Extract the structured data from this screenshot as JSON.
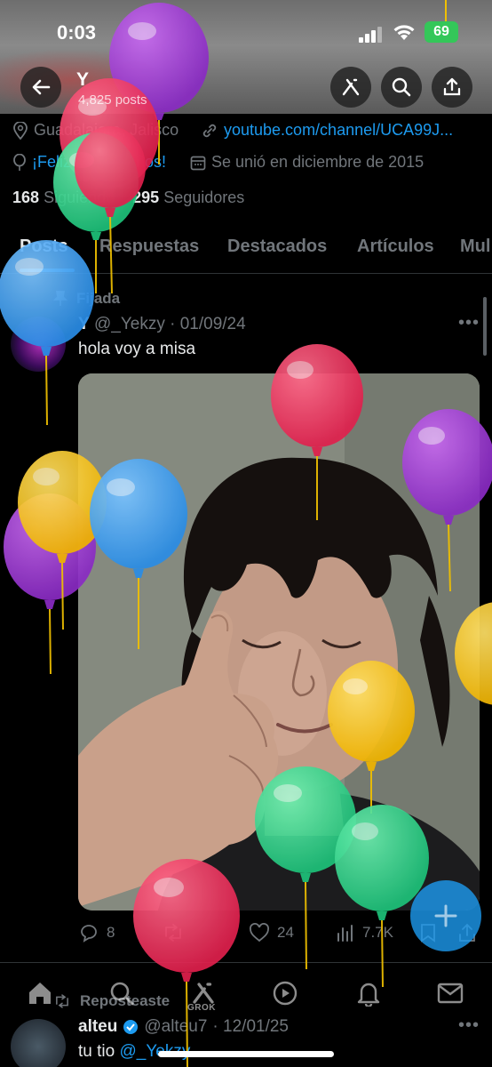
{
  "status_bar": {
    "time": "0:03",
    "battery": "69"
  },
  "header": {
    "name": "Y",
    "posts_count": "4,825 posts"
  },
  "profile": {
    "location": "Guadalajara, Jalisco",
    "website": "youtube.com/channel/UCA99J...",
    "birthday": "¡Feliz cumpleaños!",
    "joined": "Se unió en diciembre de 2015",
    "following_count": "168",
    "following_label": "Siguiendo",
    "followers_count": "295",
    "followers_label": "Seguidores"
  },
  "tabs": [
    "Posts",
    "Respuestas",
    "Destacados",
    "Artículos",
    "Mul"
  ],
  "pinned_post": {
    "pinned_label": "Fijada",
    "author": "Y",
    "handle": "@_Yekzy",
    "date": "· 01/09/24",
    "text": "hola voy a misa",
    "replies": "8",
    "likes": "24",
    "views": "7.7K"
  },
  "repost": {
    "label": "Reposteaste",
    "author": "alteu",
    "handle": "@alteu7",
    "date": "· 12/01/25",
    "text_prefix": "tu tio ",
    "mention": "@_Yekzy"
  },
  "nav": {
    "grok_label": "GROK"
  },
  "colors": {
    "accent": "#1d9bf0",
    "battery": "#34c759"
  }
}
